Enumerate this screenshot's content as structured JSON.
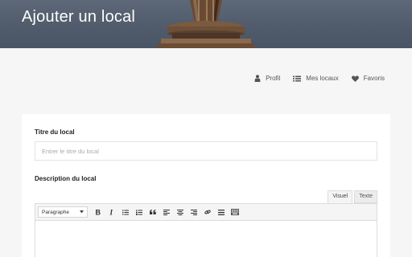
{
  "header": {
    "title": "Ajouter un local"
  },
  "nav": {
    "profile": "Profil",
    "my_places": "Mes locaux",
    "favorites": "Favoris"
  },
  "form": {
    "title_label": "Titre du local",
    "title_placeholder": "Entrer le titre du local",
    "description_label": "Description du local",
    "tab_visual": "Visuel",
    "tab_text": "Texte",
    "format_selected": "Paragraphe"
  },
  "toolbar_icons": [
    "bold-icon",
    "italic-icon",
    "bullet-list-icon",
    "numbered-list-icon",
    "blockquote-icon",
    "align-left-icon",
    "align-center-icon",
    "align-right-icon",
    "link-icon",
    "horizontal-rule-icon",
    "toolbar-toggle-icon"
  ],
  "colors": {
    "banner": "#505b6b",
    "page_bg": "#f6f6f6",
    "card_bg": "#ffffff"
  }
}
